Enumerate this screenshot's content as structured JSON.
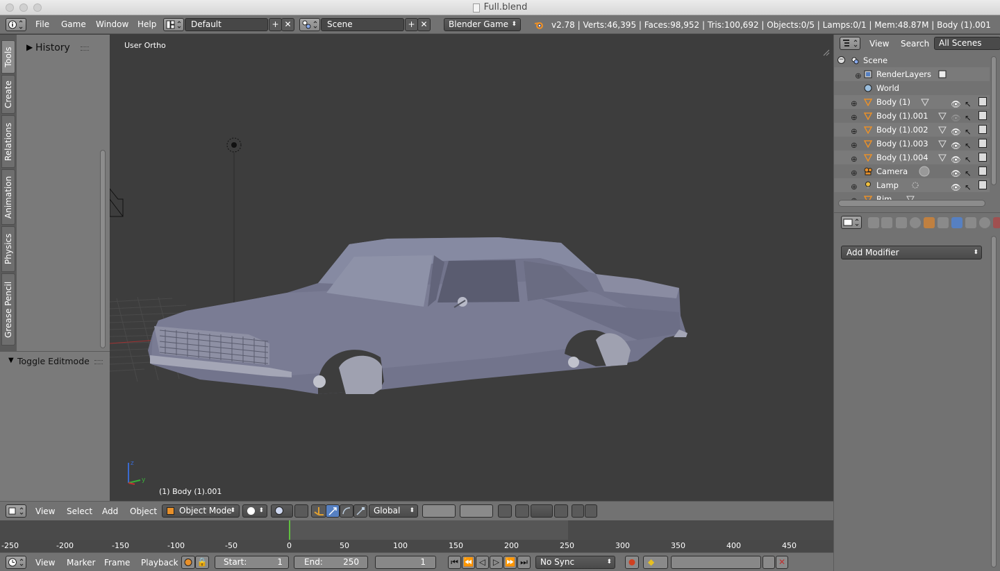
{
  "window": {
    "title": "Full.blend"
  },
  "info_header": {
    "menus": [
      "File",
      "Game",
      "Window",
      "Help"
    ],
    "layout": "Default",
    "scene": "Scene",
    "engine": "Blender Game",
    "stats": "v2.78 | Verts:46,395 | Faces:98,952 | Tris:100,692 | Objects:0/5 | Lamps:0/1 | Mem:48.87M | Body (1).001"
  },
  "tool_shelf": {
    "tabs": [
      "Tools",
      "Create",
      "Relations",
      "Animation",
      "Physics",
      "Grease Pencil"
    ],
    "history_label": "History",
    "operator_label": "Toggle Editmode"
  },
  "viewport": {
    "view_label": "User Ortho",
    "object_label": "(1) Body (1).001"
  },
  "view3d_header": {
    "menus": [
      "View",
      "Select",
      "Add",
      "Object"
    ],
    "mode": "Object Mode",
    "orientation": "Global"
  },
  "timeline": {
    "ticks": [
      "-250",
      "-200",
      "-150",
      "-100",
      "-50",
      "0",
      "50",
      "100",
      "150",
      "200",
      "250",
      "300",
      "350",
      "400",
      "450"
    ],
    "menus": [
      "View",
      "Marker",
      "Frame",
      "Playback"
    ],
    "start_label": "Start:",
    "start_value": "1",
    "end_label": "End:",
    "end_value": "250",
    "current_frame": "1",
    "sync": "No Sync"
  },
  "outliner": {
    "menus": [
      "View",
      "Search"
    ],
    "scope": "All Scenes",
    "items": [
      {
        "name": "Scene",
        "type": "scene"
      },
      {
        "name": "RenderLayers",
        "type": "renderlayers"
      },
      {
        "name": "World",
        "type": "world"
      },
      {
        "name": "Body (1)",
        "type": "mesh"
      },
      {
        "name": "Body (1).001",
        "type": "mesh"
      },
      {
        "name": "Body (1).002",
        "type": "mesh"
      },
      {
        "name": "Body (1).003",
        "type": "mesh"
      },
      {
        "name": "Body (1).004",
        "type": "mesh"
      },
      {
        "name": "Camera",
        "type": "camera"
      },
      {
        "name": "Lamp",
        "type": "lamp"
      },
      {
        "name": "Rim",
        "type": "mesh"
      }
    ]
  },
  "properties": {
    "add_modifier_label": "Add Modifier"
  },
  "colors": {
    "accent_orange": "#e8902a",
    "active_tab_blue": "#5680c2",
    "frame_cursor_green": "#60c040"
  }
}
